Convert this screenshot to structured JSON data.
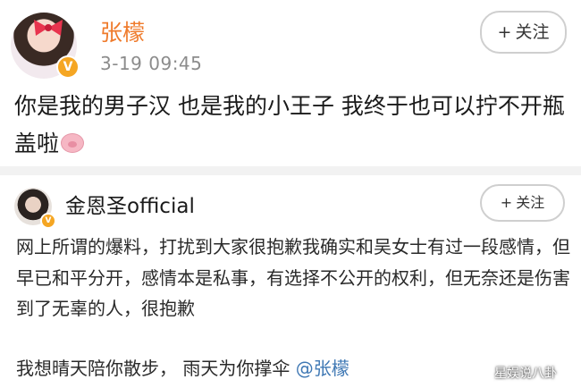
{
  "post": {
    "author": "张檬",
    "timestamp": "3-19 09:45",
    "follow_label": "关注",
    "follow_plus": "+",
    "text": "你是我的男子汉  也是我的小王子  我终于也可以拧不开瓶盖啦",
    "emoji": "pig-emoji"
  },
  "quoted": {
    "author": "金恩圣official",
    "follow_label": "关注",
    "follow_plus": "+",
    "text": "网上所谓的爆料，打扰到大家很抱歉我确实和吴女士有过一段感情，但早已和平分开，感情本是私事，有选择不公开的权利，但无奈还是伤害到了无辜的人，很抱歉",
    "extra_text": "我想晴天陪你散步，  雨天为你撑伞",
    "mention": "@张檬"
  },
  "verified_badge": "V",
  "watermark": "星娱说八卦",
  "colors": {
    "author_name": "#ef7b2c",
    "verified_badge": "#f5a623",
    "mention": "#3f78b4",
    "timestamp": "#8c8c8c"
  }
}
